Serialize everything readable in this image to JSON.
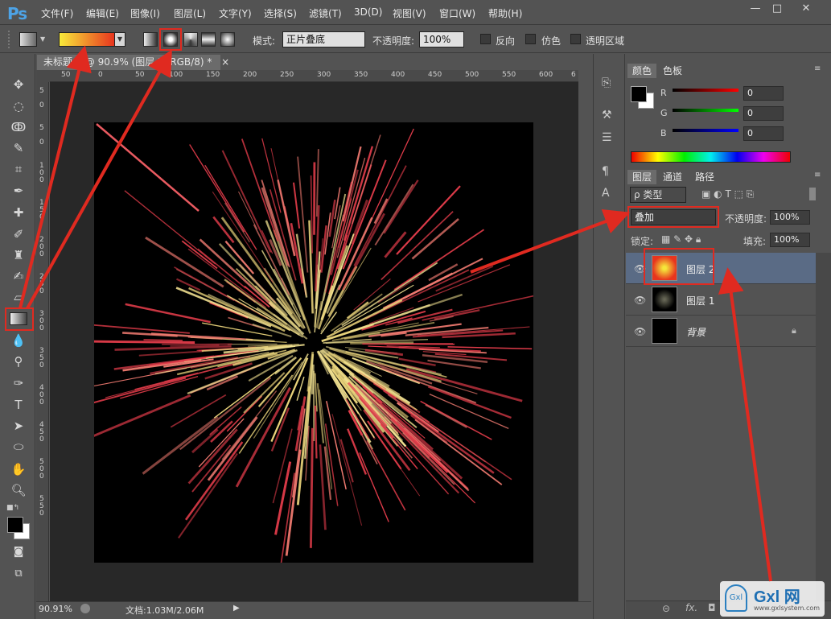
{
  "app": {
    "logo": "Ps"
  },
  "menu": [
    "文件(F)",
    "编辑(E)",
    "图像(I)",
    "图层(L)",
    "文字(Y)",
    "选择(S)",
    "滤镜(T)",
    "3D(D)",
    "视图(V)",
    "窗口(W)",
    "帮助(H)"
  ],
  "window_controls": {
    "minimize": "—",
    "maximize": "□",
    "close": "✕"
  },
  "options": {
    "mode_label": "模式:",
    "mode_value": "正片叠底",
    "opacity_label": "不透明度:",
    "opacity_value": "100%",
    "reverse_label": "反向",
    "dither_label": "仿色",
    "transparency_label": "透明区域"
  },
  "document": {
    "tab_title": "未标题-1 @ 90.9% (图层 2, RGB/8) *",
    "tab_close": "×",
    "zoom": "90.91%",
    "doc_info": "文档:1.03M/2.06M"
  },
  "ruler": {
    "h_labels": [
      "50",
      "0",
      "50",
      "100",
      "150",
      "200",
      "250",
      "300",
      "350",
      "400",
      "450",
      "500",
      "550",
      "600",
      "6"
    ],
    "v_labels": [
      "5",
      "0",
      "5",
      "0",
      "1\n0\n0",
      "1\n5\n0",
      "2\n0\n0",
      "2\n5\n0",
      "3\n0\n0",
      "3\n5\n0",
      "4\n0\n0",
      "4\n5\n0",
      "5\n0\n0",
      "5\n5\n0"
    ]
  },
  "color_panel": {
    "tabs": [
      "颜色",
      "色板"
    ],
    "r_label": "R",
    "g_label": "G",
    "b_label": "B",
    "r_value": "0",
    "g_value": "0",
    "b_value": "0"
  },
  "layers_panel": {
    "tabs": [
      "图层",
      "通道",
      "路径"
    ],
    "filter_label": "ρ 类型",
    "blend_mode": "叠加",
    "opacity_label": "不透明度:",
    "opacity_value": "100%",
    "lock_label": "锁定:",
    "fill_label": "填充:",
    "fill_value": "100%",
    "layers": [
      {
        "name": "图层 2",
        "selected": true
      },
      {
        "name": "图层 1",
        "selected": false
      },
      {
        "name": "背景",
        "selected": false
      }
    ],
    "footer_icons": [
      "link-icon",
      "fx-icon",
      "mask-icon"
    ]
  },
  "watermark": {
    "text": "Gxl 网",
    "url": "www.gxlsystem.com"
  },
  "colors": {
    "accent_red": "#e02a20",
    "panel_bg": "#535353",
    "selected_layer": "#5a6b85"
  }
}
